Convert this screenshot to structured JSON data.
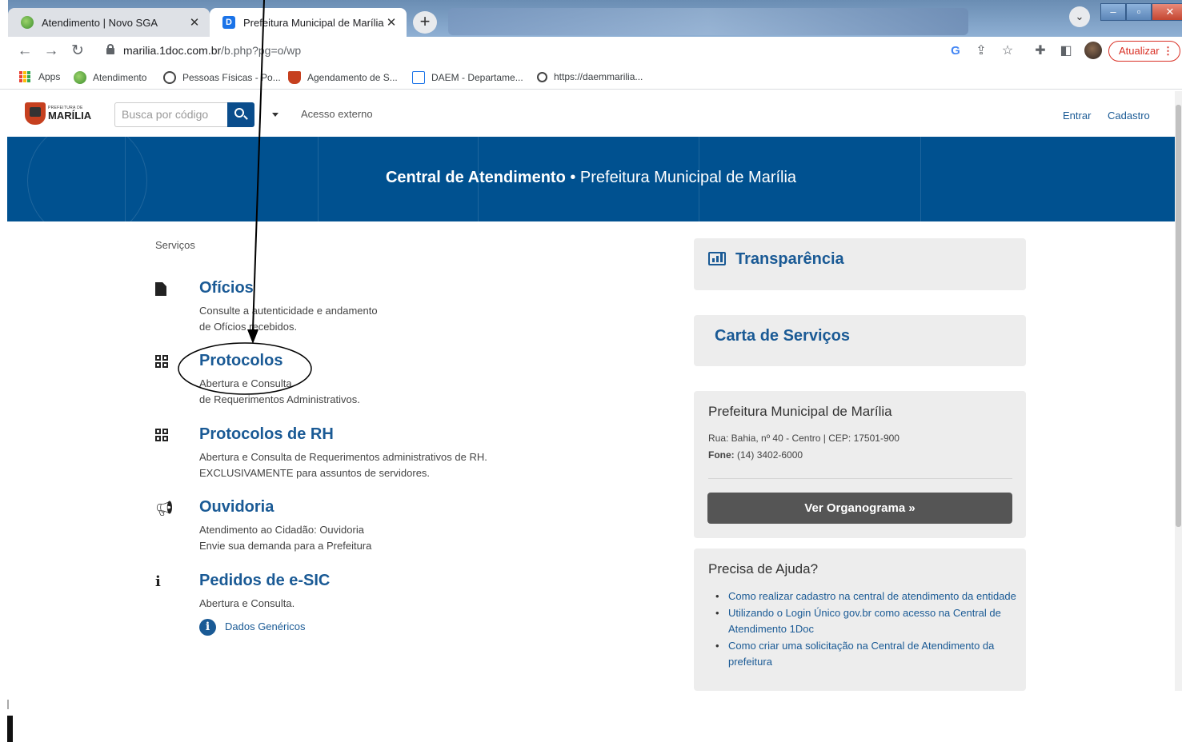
{
  "browser": {
    "tabs": [
      {
        "title": "Atendimento | Novo SGA",
        "close": "✕",
        "active": false
      },
      {
        "title": "Prefeitura Municipal de Marília |",
        "close": "✕",
        "active": true
      }
    ],
    "new_tab": "+",
    "url_host": "marilia.1doc.com.br",
    "url_path": "/b.php?pg=o/wp",
    "update_label": "Atualizar",
    "bookmarks": [
      {
        "label": "Apps",
        "icon": "apps-grid-icon"
      },
      {
        "label": "Atendimento",
        "icon": "sga-icon"
      },
      {
        "label": "Pessoas Físicas - Po...",
        "icon": "globe-icon"
      },
      {
        "label": "Agendamento de S...",
        "icon": "crest-icon"
      },
      {
        "label": "DAEM - Departame...",
        "icon": "drop-icon"
      },
      {
        "label": "https://daemmarilia...",
        "icon": "d-icon"
      }
    ]
  },
  "header": {
    "logo_small": "PREFEITURA DE",
    "logo_big": "MARÍLIA",
    "search_placeholder": "Busca por código",
    "external_access": "Acesso externo",
    "login": "Entrar",
    "register": "Cadastro"
  },
  "banner": {
    "title_bold": "Central de Atendimento",
    "separator": " • ",
    "title_rest": "Prefeitura Municipal de Marília"
  },
  "services": {
    "label": "Serviços",
    "items": [
      {
        "title": "Ofícios",
        "line1": "Consulte a autenticidade e andamento",
        "line2": "de Ofícios recebidos.",
        "icon": "document-icon"
      },
      {
        "title": "Protocolos",
        "line1": "Abertura e Consulta",
        "line2": "de Requerimentos Administrativos.",
        "icon": "qrcode-icon"
      },
      {
        "title": "Protocolos de RH",
        "line1": "Abertura e Consulta de Requerimentos administrativos de RH.",
        "line2": "EXCLUSIVAMENTE para assuntos de servidores.",
        "icon": "qrcode-icon"
      },
      {
        "title": "Ouvidoria",
        "line1": "Atendimento ao Cidadão: Ouvidoria",
        "line2": "Envie sua demanda para a Prefeitura",
        "icon": "megaphone-icon"
      },
      {
        "title": "Pedidos de e-SIC",
        "line1": "Abertura e Consulta.",
        "line2": "",
        "icon": "info-icon"
      }
    ],
    "dados_link": "Dados Genéricos"
  },
  "sidebar": {
    "transparency": "Transparência",
    "services_letter": "Carta de Serviços",
    "org": {
      "name": "Prefeitura Municipal de Marília",
      "address": "Rua: Bahia, nº 40 - Centro | CEP: 17501-900",
      "phone_label": "Fone:",
      "phone": "(14) 3402-6000",
      "button": "Ver Organograma »"
    },
    "help": {
      "title": "Precisa de Ajuda?",
      "links": [
        "Como realizar cadastro na central de atendimento da entidade",
        "Utilizando o Login Único gov.br como acesso na Central de Atendimento 1Doc",
        "Como criar uma solicitação na Central de Atendimento da prefeitura"
      ]
    }
  },
  "colors": {
    "brand_blue": "#005190",
    "link_blue": "#1a5a95",
    "card_gray": "#ededed",
    "button_gray": "#555555"
  }
}
